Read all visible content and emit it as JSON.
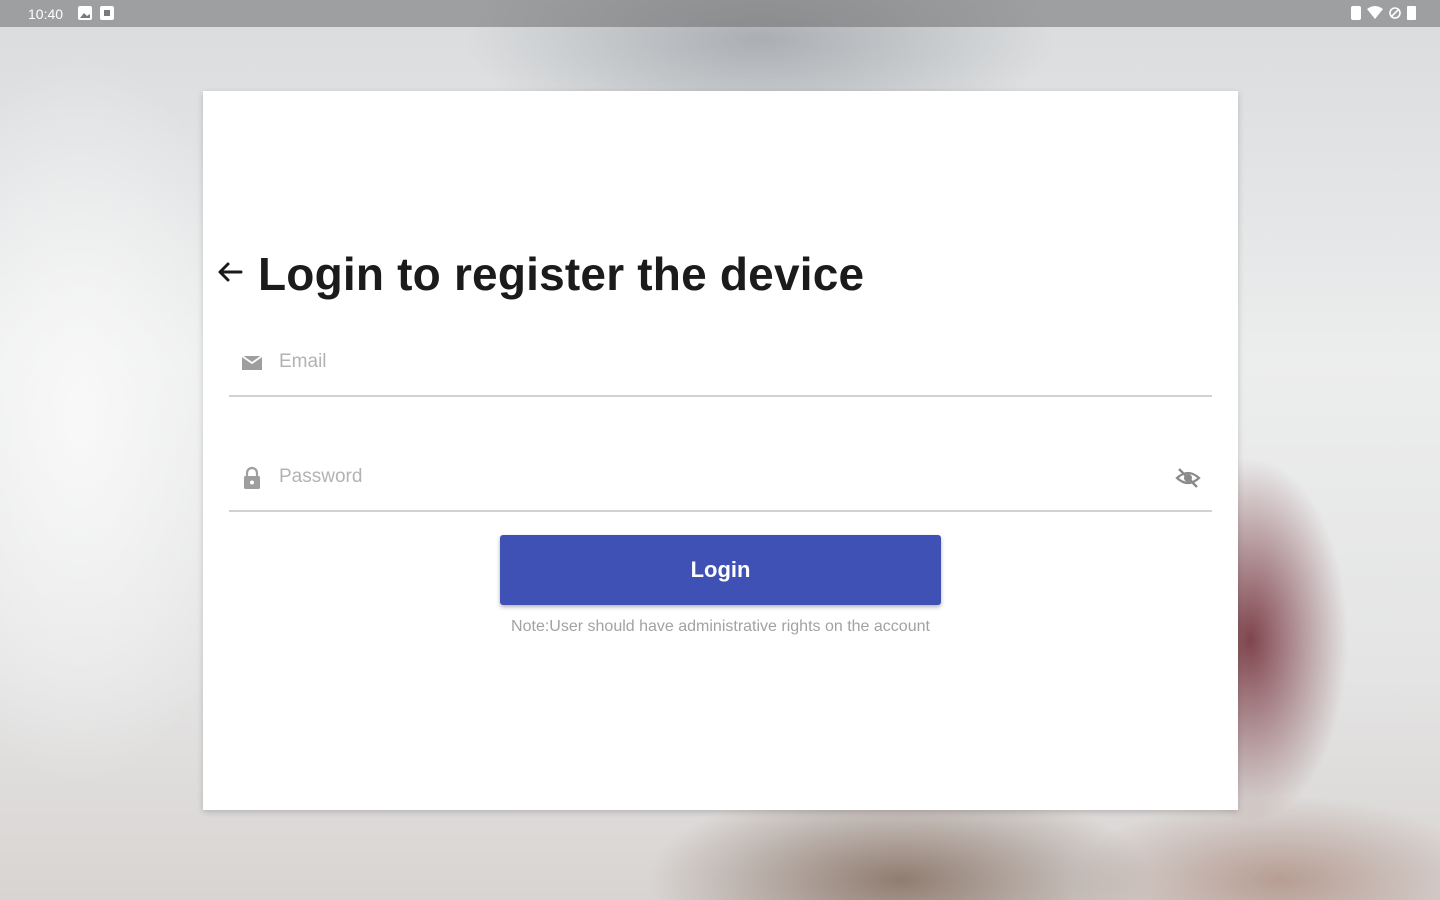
{
  "status_bar": {
    "time": "10:40"
  },
  "login": {
    "title": "Login to register the device",
    "email_placeholder": "Email",
    "password_placeholder": "Password",
    "button_label": "Login",
    "note": "Note:User should have administrative rights on the account"
  },
  "colors": {
    "accent": "#3f51b5",
    "card": "#ffffff",
    "title_text": "#1b1b1b",
    "placeholder": "#b3b3b3",
    "icon": "#9e9e9e"
  },
  "icons": {
    "back": "arrow-back-icon",
    "email": "mail-icon",
    "password": "lock-icon",
    "visibility": "visibility-off-icon"
  }
}
